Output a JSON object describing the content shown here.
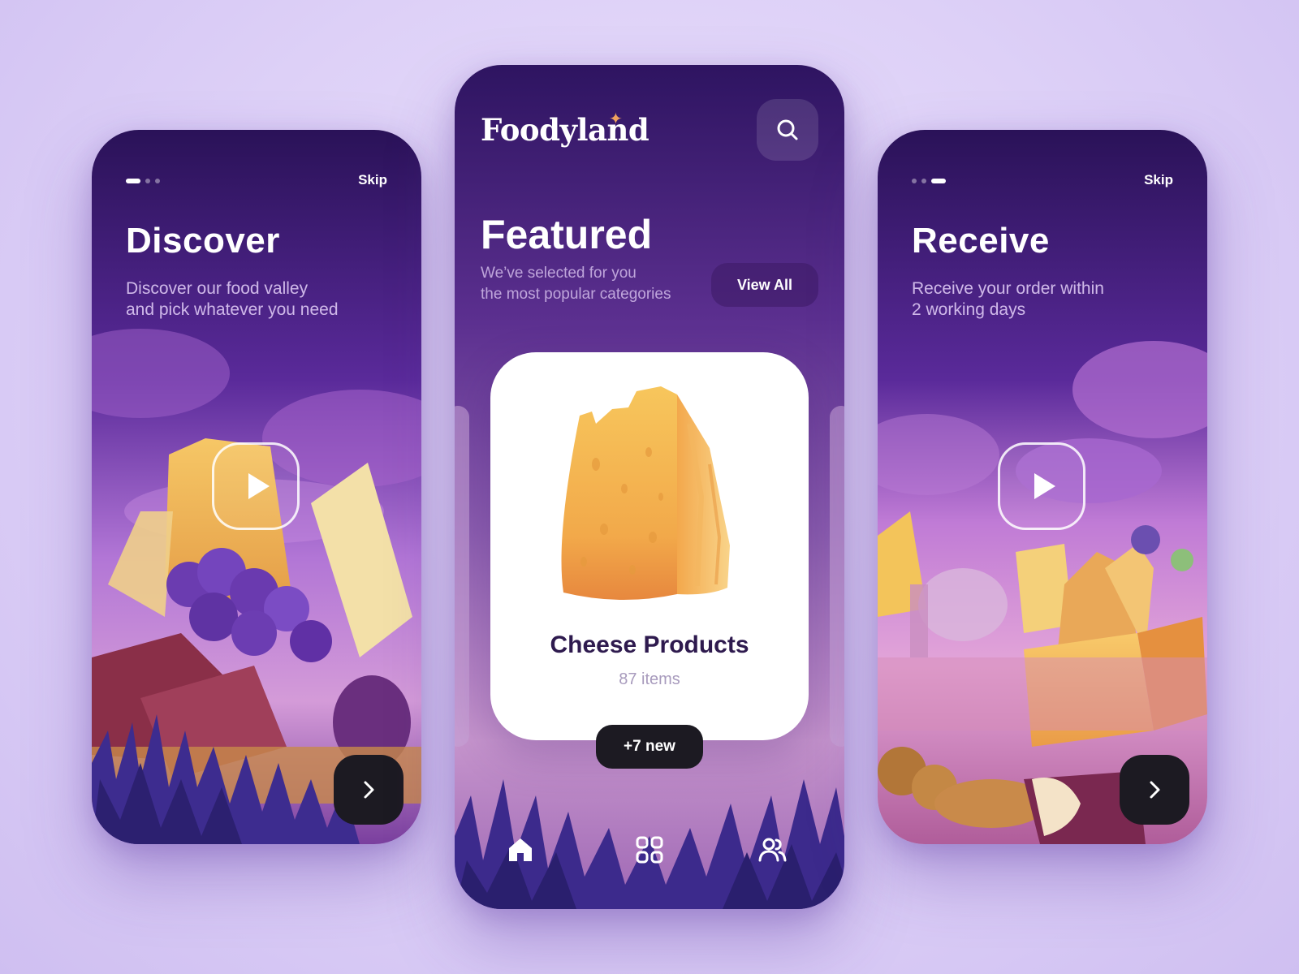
{
  "screens": {
    "discover": {
      "skip_label": "Skip",
      "title": "Discover",
      "description_lines": [
        "Discover our food valley",
        "and pick whatever you need"
      ],
      "page_indicator": {
        "total": 3,
        "active": 1
      },
      "icons": {
        "play": "play-icon",
        "next": "chevron-right-icon"
      }
    },
    "home": {
      "logo": "Foodyland",
      "title": "Featured",
      "subtitle_lines": [
        "We’ve selected for you",
        "the most popular categories"
      ],
      "view_all_label": "View All",
      "category": {
        "name": "Cheese Products",
        "count": "87 items",
        "badge": "+7 new"
      },
      "tabs": [
        {
          "name": "home",
          "icon": "home-icon",
          "active": true
        },
        {
          "name": "categories",
          "icon": "grid-icon",
          "active": false
        },
        {
          "name": "community",
          "icon": "users-icon",
          "active": false
        }
      ],
      "icons": {
        "search": "search-icon",
        "sparkle": "sparkle-icon"
      }
    },
    "receive": {
      "skip_label": "Skip",
      "title": "Receive",
      "description_lines": [
        "Receive your order within",
        "2 working days"
      ],
      "page_indicator": {
        "total": 3,
        "active": 3
      },
      "icons": {
        "play": "play-icon",
        "next": "chevron-right-icon"
      }
    }
  },
  "colors": {
    "page_background": "#e4d9f8",
    "screen_top": "#2c1560",
    "screen_mid": "#7a44b8",
    "screen_glow": "#c98fe0",
    "button_dark": "#1c1a22",
    "cheese": "#f5b84c",
    "card_title": "#2e1a4e",
    "logo_star": "#f0a25e"
  }
}
